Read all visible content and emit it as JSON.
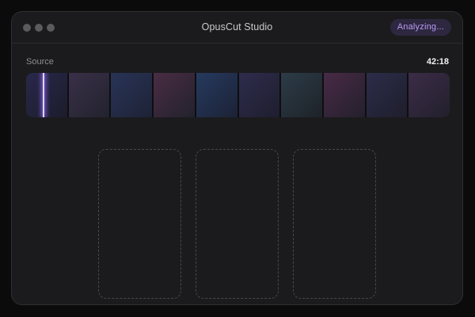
{
  "window": {
    "title": "OpusCut Studio",
    "status": "Analyzing..."
  },
  "source": {
    "label": "Source",
    "duration": "42:18",
    "frames": [
      {
        "from": "#28284a",
        "to": "#1c1c2c"
      },
      {
        "from": "#3a3048",
        "to": "#22222e"
      },
      {
        "from": "#283456",
        "to": "#1e2236"
      },
      {
        "from": "#4a2c44",
        "to": "#22222c"
      },
      {
        "from": "#263a5e",
        "to": "#1c2236"
      },
      {
        "from": "#2e2c4c",
        "to": "#1e1e2e"
      },
      {
        "from": "#2c3c48",
        "to": "#1e2228"
      },
      {
        "from": "#482a46",
        "to": "#24202c"
      },
      {
        "from": "#2c2c4a",
        "to": "#1e1e2c"
      },
      {
        "from": "#3c2c48",
        "to": "#22202c"
      }
    ]
  },
  "clips": {
    "slots": 3
  },
  "colors": {
    "accent": "#b89cf4",
    "badge_bg": "#2e2740",
    "playhead": "#e2d4ff"
  }
}
